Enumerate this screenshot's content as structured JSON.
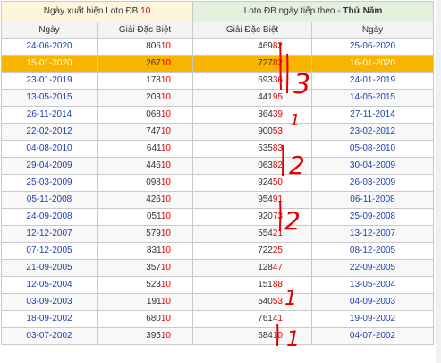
{
  "header": {
    "left_prefix": "Ngày xuất hiện Loto ĐB ",
    "left_value": "10",
    "right_prefix": "Loto ĐB ngày tiếp theo - ",
    "right_day": "Thứ Năm"
  },
  "columns": [
    "Ngày",
    "Giải Đặc Biệt",
    "Giải Đặc Biệt",
    "Ngày"
  ],
  "rows": [
    {
      "d1": "24-06-2020",
      "p1": "806",
      "s1": "10",
      "p2": "469",
      "s2": "82",
      "d2": "25-06-2020"
    },
    {
      "d1": "15-01-2020",
      "p1": "267",
      "s1": "10",
      "p2": "727",
      "s2": "82",
      "d2": "16-01-2020"
    },
    {
      "d1": "23-01-2019",
      "p1": "178",
      "s1": "10",
      "p2": "693",
      "s2": "36",
      "d2": "24-01-2019"
    },
    {
      "d1": "13-05-2015",
      "p1": "203",
      "s1": "10",
      "p2": "441",
      "s2": "95",
      "d2": "14-05-2015"
    },
    {
      "d1": "26-11-2014",
      "p1": "068",
      "s1": "10",
      "p2": "364",
      "s2": "39",
      "d2": "27-11-2014"
    },
    {
      "d1": "22-02-2012",
      "p1": "747",
      "s1": "10",
      "p2": "900",
      "s2": "53",
      "d2": "23-02-2012"
    },
    {
      "d1": "04-08-2010",
      "p1": "641",
      "s1": "10",
      "p2": "635",
      "s2": "83",
      "d2": "05-08-2010"
    },
    {
      "d1": "29-04-2009",
      "p1": "446",
      "s1": "10",
      "p2": "063",
      "s2": "82",
      "d2": "30-04-2009"
    },
    {
      "d1": "25-03-2009",
      "p1": "098",
      "s1": "10",
      "p2": "924",
      "s2": "50",
      "d2": "26-03-2009"
    },
    {
      "d1": "05-11-2008",
      "p1": "426",
      "s1": "10",
      "p2": "954",
      "s2": "91",
      "d2": "06-11-2008"
    },
    {
      "d1": "24-09-2008",
      "p1": "051",
      "s1": "10",
      "p2": "920",
      "s2": "73",
      "d2": "25-09-2008"
    },
    {
      "d1": "12-12-2007",
      "p1": "579",
      "s1": "10",
      "p2": "554",
      "s2": "21",
      "d2": "13-12-2007"
    },
    {
      "d1": "07-12-2005",
      "p1": "831",
      "s1": "10",
      "p2": "722",
      "s2": "25",
      "d2": "08-12-2005"
    },
    {
      "d1": "21-09-2005",
      "p1": "357",
      "s1": "10",
      "p2": "128",
      "s2": "47",
      "d2": "22-09-2005"
    },
    {
      "d1": "12-05-2004",
      "p1": "523",
      "s1": "10",
      "p2": "151",
      "s2": "88",
      "d2": "13-05-2004"
    },
    {
      "d1": "03-09-2003",
      "p1": "191",
      "s1": "10",
      "p2": "540",
      "s2": "53",
      "d2": "04-09-2003"
    },
    {
      "d1": "18-09-2002",
      "p1": "680",
      "s1": "10",
      "p2": "761",
      "s2": "41",
      "d2": "19-09-2002"
    },
    {
      "d1": "03-07-2002",
      "p1": "395",
      "s1": "10",
      "p2": "684",
      "s2": "10",
      "d2": "04-07-2002"
    }
  ],
  "highlight_row": 1,
  "annotations": [
    "3",
    "1",
    "2",
    "2",
    "1",
    "1"
  ],
  "colors": {
    "highlight": "#f9b400",
    "date": "#1f3fb3",
    "suffix": "#e00000",
    "marker": "#e00000"
  }
}
